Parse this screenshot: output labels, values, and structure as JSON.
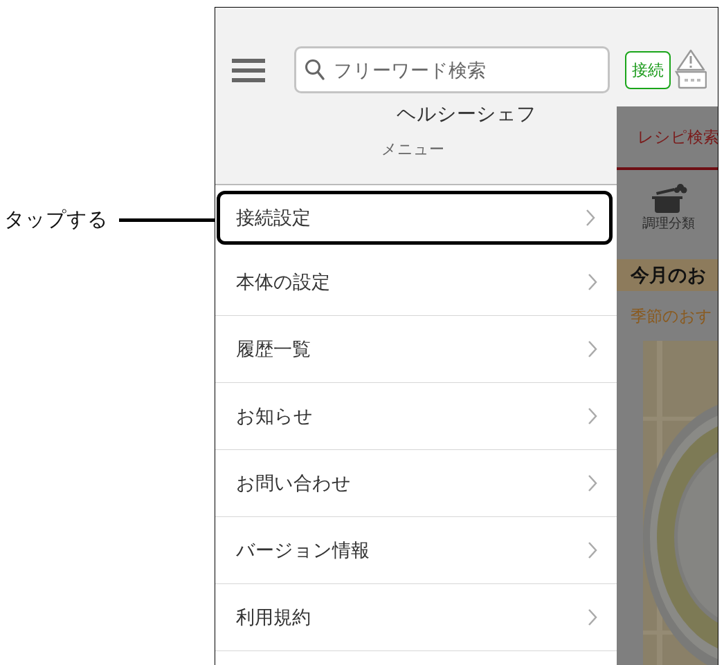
{
  "callout": {
    "label": "タップする"
  },
  "header": {
    "search": {
      "placeholder": "フリーワード検索"
    },
    "connect_button": "接続"
  },
  "app_title": "ヘルシーシェフ",
  "menu_title": "メニュー",
  "menu_items": [
    {
      "label": "接続設定",
      "highlighted": true
    },
    {
      "label": "本体の設定",
      "highlighted": false
    },
    {
      "label": "履歴一覧",
      "highlighted": false
    },
    {
      "label": "お知らせ",
      "highlighted": false
    },
    {
      "label": "お問い合わせ",
      "highlighted": false
    },
    {
      "label": "バージョン情報",
      "highlighted": false
    },
    {
      "label": "利用規約",
      "highlighted": false
    }
  ],
  "background_screen": {
    "tab": "レシピ検索",
    "category": "調理分類",
    "section_title": "今月のお",
    "section_subtitle": "季節のおす"
  }
}
